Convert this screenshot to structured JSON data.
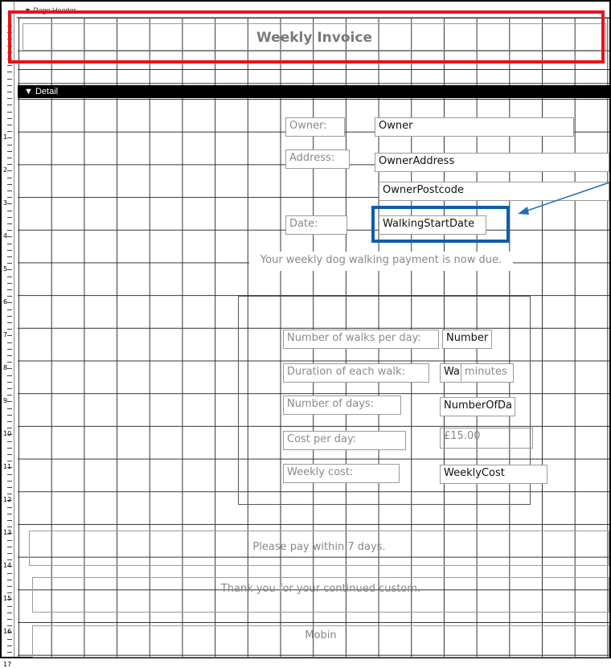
{
  "page_header": {
    "band_label": "Page Header",
    "title": "Weekly Invoice"
  },
  "detail": {
    "band_label": "Detail"
  },
  "controls": {
    "owner_label": "Owner:",
    "owner_field": "Owner",
    "address_label": "Address:",
    "address_field": "OwnerAddress",
    "postcode_field": "OwnerPostcode",
    "date_label": "Date:",
    "date_field": "WalkingStartDate",
    "due_text": "Your weekly dog walking payment is now due.",
    "walks_label": "Number of walks per day:",
    "walks_field": "Number",
    "duration_label": "Duration of each walk:",
    "duration_field_a": "Wa",
    "duration_field_b": "minutes",
    "days_label": "Number of days:",
    "days_field": "NumberOfDa",
    "cost_label": "Cost per day:",
    "cost_field": "£15.00",
    "weekly_label": "Weekly cost:",
    "weekly_field": "WeeklyCost",
    "pay_text": "Please pay within 7 days.",
    "thanks_text": "Thank you for your continued custom.",
    "signature": "Mobin"
  },
  "ruler": {
    "numbers": [
      "1",
      "2",
      "3",
      "4",
      "5",
      "6",
      "7",
      "8",
      "9",
      "10",
      "11",
      "12",
      "13",
      "14",
      "15",
      "16",
      "17"
    ]
  },
  "colors": {
    "highlight_red": "#e8121a",
    "highlight_blue": "#0f5cad",
    "detail_bar": "#000000"
  }
}
